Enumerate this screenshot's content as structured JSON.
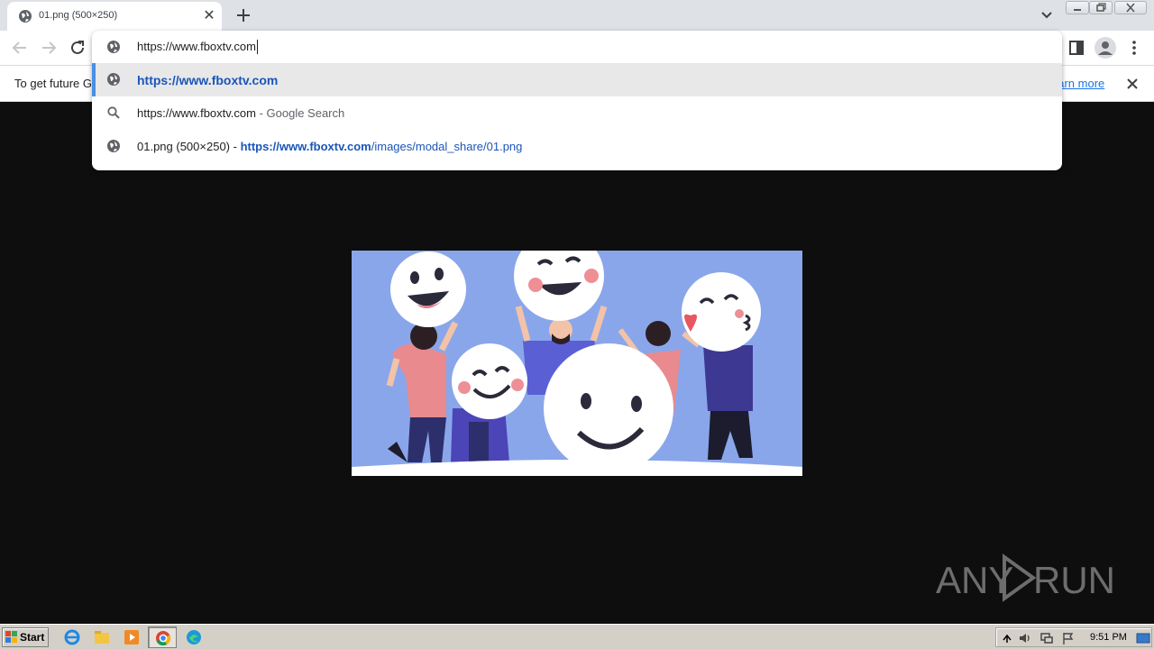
{
  "tab": {
    "title": "01.png (500×250)",
    "close": "✕"
  },
  "omnibox": {
    "input": "https://www.fboxtv.com",
    "suggestions": [
      {
        "prefix": "",
        "url": "https://www.fboxtv.com",
        "url_rest": "",
        "suffix": ""
      },
      {
        "prefix": "",
        "url": "",
        "url_rest": "",
        "text": "https://www.fboxtv.com",
        "suffix": " - Google Search"
      },
      {
        "prefix": "01.png (500×250) - ",
        "url": "https://www.fboxtv.com",
        "url_rest": "/images/modal_share/01.png",
        "suffix": ""
      }
    ]
  },
  "infobar": {
    "text": "To get future G",
    "link": "earn more"
  },
  "image": {
    "alt": "01.png"
  },
  "watermark": "ANY RUN",
  "taskbar": {
    "start": "Start",
    "clock": "9:51 PM"
  },
  "colors": {
    "accent": "#1a73e8",
    "selection_bar": "#4a90e2",
    "image_bg": "#8aa6ea"
  },
  "icons": [
    "globe-icon",
    "search-icon",
    "back-icon",
    "forward-icon",
    "reload-icon",
    "side-panel-icon",
    "profile-icon",
    "menu-icon",
    "close-icon",
    "new-tab-icon",
    "tab-search-icon"
  ]
}
